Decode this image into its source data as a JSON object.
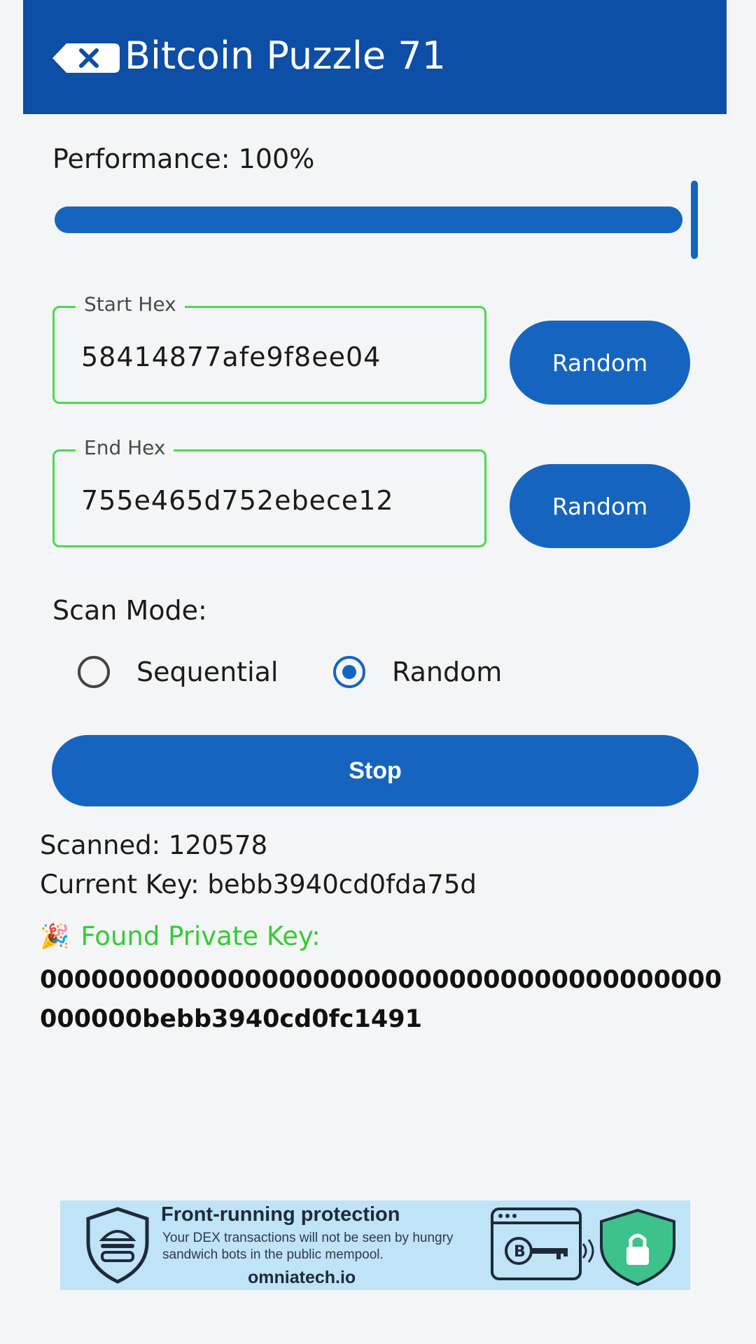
{
  "appbar": {
    "title": "Bitcoin Puzzle 71",
    "back_icon": "backspace-icon"
  },
  "performance": {
    "label": "Performance: 100%",
    "value_percent": 100
  },
  "start_hex": {
    "label": "Start Hex",
    "value": "58414877afe9f8ee04",
    "button": "Random"
  },
  "end_hex": {
    "label": "End Hex",
    "value": "755e465d752ebece12",
    "button": "Random"
  },
  "scan_mode": {
    "label": "Scan Mode:",
    "options": [
      "Sequential",
      "Random"
    ],
    "selected": "Random"
  },
  "stop_button": "Stop",
  "stats": {
    "scanned": "Scanned: 120578",
    "current_key": "Current Key: bebb3940cd0fda75d"
  },
  "found": {
    "label": "Found Private Key:",
    "key": "0000000000000000000000000000000000000000000000bebb3940cd0fc1491"
  },
  "ad": {
    "title": "Front-running protection",
    "body": "Your DEX transactions will not be seen by hungry sandwich bots in the public mempool.",
    "domain": "omniatech.io"
  },
  "colors": {
    "primary": "#1565c0",
    "appbar": "#0d4ea6",
    "field_border": "#4cd94c",
    "found_green": "#33cc33"
  }
}
